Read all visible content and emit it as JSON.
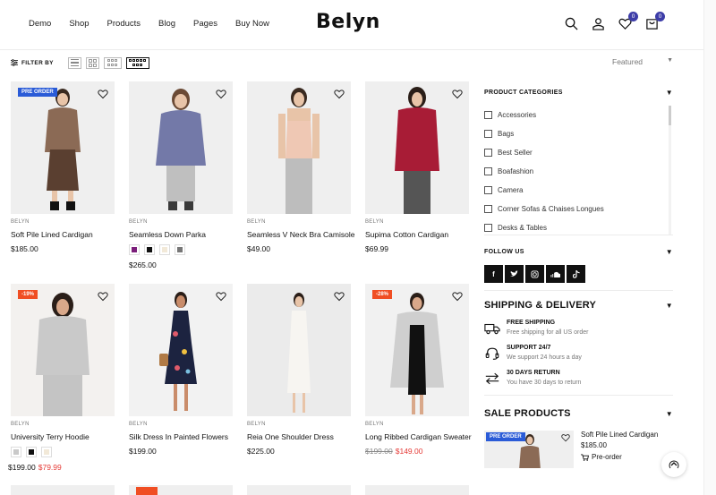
{
  "header": {
    "nav": [
      "Demo",
      "Shop",
      "Products",
      "Blog",
      "Pages",
      "Buy Now"
    ],
    "logo": "Belyn",
    "wishlist_count": "0",
    "cart_count": "0"
  },
  "toolbar": {
    "filter_label": "FILTER BY",
    "sort_value": "Featured"
  },
  "products": [
    {
      "brand": "BELYN",
      "name": "Soft Pile Lined Cardigan",
      "price": "$185.00",
      "tag": "PRE ORDER"
    },
    {
      "brand": "BELYN",
      "name": "Seamless Down Parka",
      "price": "$265.00",
      "swatches": [
        "#7b1e7a",
        "#111111",
        "#f2e9d8",
        "#777777"
      ]
    },
    {
      "brand": "BELYN",
      "name": "Seamless V Neck Bra Camisole",
      "price": "$49.00"
    },
    {
      "brand": "BELYN",
      "name": "Supima Cotton Cardigan",
      "price": "$69.99"
    },
    {
      "brand": "BELYN",
      "name": "University Terry Hoodie",
      "old_price": "$199.00",
      "new_price": "$79.99",
      "tag": "-19%",
      "swatches": [
        "#c9c9c9",
        "#111111",
        "#f2e9d8"
      ]
    },
    {
      "brand": "BELYN",
      "name": "Silk Dress In Painted Flowers",
      "price": "$199.00"
    },
    {
      "brand": "BELYN",
      "name": "Reia One Shoulder Dress",
      "price": "$225.00"
    },
    {
      "brand": "BELYN",
      "name": "Long Ribbed Cardigan Sweater",
      "old_price": "$199.00",
      "new_price": "$149.00",
      "tag": "-28%"
    }
  ],
  "sidebar": {
    "categories_title": "PRODUCT CATEGORIES",
    "categories": [
      "Accessories",
      "Bags",
      "Best Seller",
      "Boafashion",
      "Camera",
      "Corner Sofas & Chaises Longues",
      "Desks & Tables"
    ],
    "follow_title": "FOLLOW US",
    "social_icons": [
      "facebook-icon",
      "twitter-icon",
      "instagram-icon",
      "soundcloud-icon",
      "tiktok-icon"
    ],
    "shipping_title": "SHIPPING & DELIVERY",
    "features": [
      {
        "title": "FREE SHIPPING",
        "desc": "Free shipping for all US order"
      },
      {
        "title": "SUPPORT 24/7",
        "desc": "We support 24 hours a day"
      },
      {
        "title": "30 DAYS RETURN",
        "desc": "You have 30 days to return"
      }
    ],
    "sale_title": "SALE PRODUCTS",
    "sale_item": {
      "tag": "PRE ORDER",
      "name": "Soft Pile Lined Cardigan",
      "price": "$185.00",
      "action": "Pre-order"
    }
  },
  "colors": {
    "accent": "#3d3da8",
    "pre_order": "#2a5bd7",
    "sale": "#f04e23",
    "sale_price": "#e53935"
  }
}
